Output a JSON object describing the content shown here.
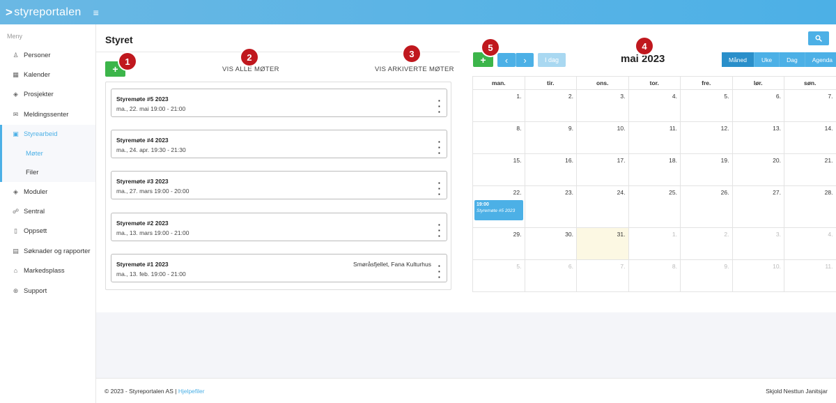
{
  "app": {
    "logo_text": "styreportalen",
    "logo_chevron": ">"
  },
  "sidebar": {
    "menu_label": "Meny",
    "items": [
      {
        "label": "Personer",
        "icon": "person-icon"
      },
      {
        "label": "Kalender",
        "icon": "calendar-icon"
      },
      {
        "label": "Prosjekter",
        "icon": "layers-icon"
      },
      {
        "label": "Meldingssenter",
        "icon": "mail-icon"
      },
      {
        "label": "Styrearbeid",
        "icon": "briefcase-icon",
        "active": true
      },
      {
        "label": "Moduler",
        "icon": "layers-icon"
      },
      {
        "label": "Sentral",
        "icon": "sitemap-icon"
      },
      {
        "label": "Oppsett",
        "icon": "mobile-icon"
      },
      {
        "label": "Søknader og rapporter",
        "icon": "document-icon"
      },
      {
        "label": "Markedsplass",
        "icon": "shop-icon"
      },
      {
        "label": "Support",
        "icon": "lifebuoy-icon"
      }
    ],
    "sub_items": [
      {
        "label": "Møter",
        "active": true
      },
      {
        "label": "Filer"
      }
    ]
  },
  "page": {
    "title": "Styret",
    "add_label": "+",
    "show_all_label": "VIS ALLE MØTER",
    "show_archived_label": "VIS ARKIVERTE MØTER"
  },
  "badges": [
    "1",
    "2",
    "3",
    "4",
    "5"
  ],
  "meetings": [
    {
      "title": "Styremøte #5 2023",
      "date": "ma., 22. mai 19:00 - 21:00",
      "location": ""
    },
    {
      "title": "Styremøte #4 2023",
      "date": "ma., 24. apr. 19:30 - 21:30",
      "location": ""
    },
    {
      "title": "Styremøte #3 2023",
      "date": "ma., 27. mars 19:00 - 20:00",
      "location": ""
    },
    {
      "title": "Styremøte #2 2023",
      "date": "ma., 13. mars 19:00 - 21:00",
      "location": ""
    },
    {
      "title": "Styremøte #1 2023",
      "date": "ma., 13. feb. 19:00 - 21:00",
      "location": "Smøråsfjellet, Fana Kulturhus"
    }
  ],
  "calendar": {
    "add_label": "+",
    "prev_label": "‹",
    "next_label": "›",
    "today_label": "I dag",
    "month_title": "mai 2023",
    "views": [
      "Måned",
      "Uke",
      "Dag",
      "Agenda"
    ],
    "active_view": "Måned",
    "weekdays": [
      "man.",
      "tir.",
      "ons.",
      "tor.",
      "fre.",
      "lør.",
      "søn."
    ],
    "weeks": [
      [
        {
          "d": "1."
        },
        {
          "d": "2."
        },
        {
          "d": "3."
        },
        {
          "d": "4."
        },
        {
          "d": "5."
        },
        {
          "d": "6."
        },
        {
          "d": "7."
        }
      ],
      [
        {
          "d": "8."
        },
        {
          "d": "9."
        },
        {
          "d": "10."
        },
        {
          "d": "11."
        },
        {
          "d": "12."
        },
        {
          "d": "13."
        },
        {
          "d": "14."
        }
      ],
      [
        {
          "d": "15."
        },
        {
          "d": "16."
        },
        {
          "d": "17."
        },
        {
          "d": "18."
        },
        {
          "d": "19."
        },
        {
          "d": "20."
        },
        {
          "d": "21."
        }
      ],
      [
        {
          "d": "22.",
          "event": {
            "time": "19:00",
            "name": "Styremøte #5 2023"
          }
        },
        {
          "d": "23."
        },
        {
          "d": "24."
        },
        {
          "d": "25."
        },
        {
          "d": "26."
        },
        {
          "d": "27."
        },
        {
          "d": "28."
        }
      ],
      [
        {
          "d": "29."
        },
        {
          "d": "30."
        },
        {
          "d": "31.",
          "today": true
        },
        {
          "d": "1.",
          "other": true
        },
        {
          "d": "2.",
          "other": true
        },
        {
          "d": "3.",
          "other": true
        },
        {
          "d": "4.",
          "other": true
        }
      ],
      [
        {
          "d": "5.",
          "other": true
        },
        {
          "d": "6.",
          "other": true
        },
        {
          "d": "7.",
          "other": true
        },
        {
          "d": "8.",
          "other": true
        },
        {
          "d": "9.",
          "other": true
        },
        {
          "d": "10.",
          "other": true
        },
        {
          "d": "11.",
          "other": true
        }
      ]
    ]
  },
  "footer": {
    "copyright": "© 2023 - Styreportalen AS | ",
    "help_link": "Hjelpefiler",
    "user": "Skjold Nesttun Janitsjar"
  }
}
